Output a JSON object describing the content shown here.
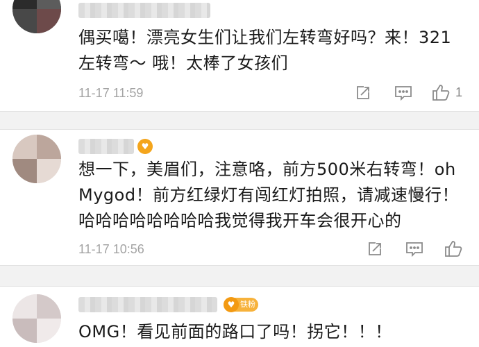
{
  "colors": {
    "text": "#1a1a1a",
    "timestamp": "#a3a3a3",
    "icon": "#8a8a8a",
    "badge": "#f4a51c",
    "separator": "#f2f2f2"
  },
  "icons": {
    "repost": "repost-icon",
    "comment": "comment-icon",
    "like": "thumbs-up-icon",
    "badge": "vip-badge-icon"
  },
  "comments": [
    {
      "text": "偶买噶！漂亮女生们让我们左转弯好吗？来！321左转弯～ 哦！太棒了女孩们",
      "time": "11-17 11:59",
      "likes": "1"
    },
    {
      "text": "想一下，美眉们，注意咯，前方500米右转弯！oh Mygod！前方红绿灯有闯红灯拍照，请减速慢行！哈哈哈哈哈哈哈哈我觉得我开车会很开心的",
      "time": "11-17 10:56",
      "likes": ""
    },
    {
      "text": "OMG！看见前面的路口了吗！拐它！！！",
      "fan_badge": "铁粉",
      "time": "",
      "likes": ""
    }
  ]
}
